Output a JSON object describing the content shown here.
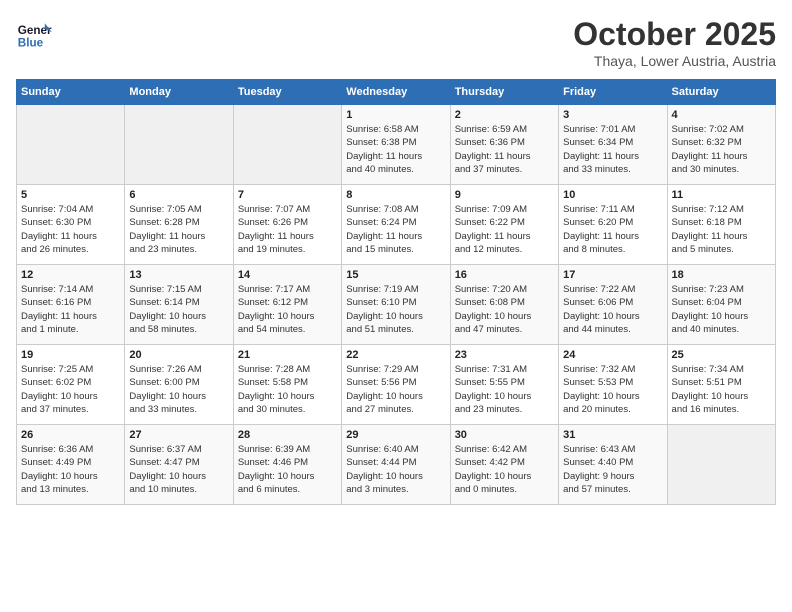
{
  "header": {
    "logo_general": "General",
    "logo_blue": "Blue",
    "month": "October 2025",
    "location": "Thaya, Lower Austria, Austria"
  },
  "days_of_week": [
    "Sunday",
    "Monday",
    "Tuesday",
    "Wednesday",
    "Thursday",
    "Friday",
    "Saturday"
  ],
  "weeks": [
    [
      {
        "day": "",
        "info": ""
      },
      {
        "day": "",
        "info": ""
      },
      {
        "day": "",
        "info": ""
      },
      {
        "day": "1",
        "info": "Sunrise: 6:58 AM\nSunset: 6:38 PM\nDaylight: 11 hours\nand 40 minutes."
      },
      {
        "day": "2",
        "info": "Sunrise: 6:59 AM\nSunset: 6:36 PM\nDaylight: 11 hours\nand 37 minutes."
      },
      {
        "day": "3",
        "info": "Sunrise: 7:01 AM\nSunset: 6:34 PM\nDaylight: 11 hours\nand 33 minutes."
      },
      {
        "day": "4",
        "info": "Sunrise: 7:02 AM\nSunset: 6:32 PM\nDaylight: 11 hours\nand 30 minutes."
      }
    ],
    [
      {
        "day": "5",
        "info": "Sunrise: 7:04 AM\nSunset: 6:30 PM\nDaylight: 11 hours\nand 26 minutes."
      },
      {
        "day": "6",
        "info": "Sunrise: 7:05 AM\nSunset: 6:28 PM\nDaylight: 11 hours\nand 23 minutes."
      },
      {
        "day": "7",
        "info": "Sunrise: 7:07 AM\nSunset: 6:26 PM\nDaylight: 11 hours\nand 19 minutes."
      },
      {
        "day": "8",
        "info": "Sunrise: 7:08 AM\nSunset: 6:24 PM\nDaylight: 11 hours\nand 15 minutes."
      },
      {
        "day": "9",
        "info": "Sunrise: 7:09 AM\nSunset: 6:22 PM\nDaylight: 11 hours\nand 12 minutes."
      },
      {
        "day": "10",
        "info": "Sunrise: 7:11 AM\nSunset: 6:20 PM\nDaylight: 11 hours\nand 8 minutes."
      },
      {
        "day": "11",
        "info": "Sunrise: 7:12 AM\nSunset: 6:18 PM\nDaylight: 11 hours\nand 5 minutes."
      }
    ],
    [
      {
        "day": "12",
        "info": "Sunrise: 7:14 AM\nSunset: 6:16 PM\nDaylight: 11 hours\nand 1 minute."
      },
      {
        "day": "13",
        "info": "Sunrise: 7:15 AM\nSunset: 6:14 PM\nDaylight: 10 hours\nand 58 minutes."
      },
      {
        "day": "14",
        "info": "Sunrise: 7:17 AM\nSunset: 6:12 PM\nDaylight: 10 hours\nand 54 minutes."
      },
      {
        "day": "15",
        "info": "Sunrise: 7:19 AM\nSunset: 6:10 PM\nDaylight: 10 hours\nand 51 minutes."
      },
      {
        "day": "16",
        "info": "Sunrise: 7:20 AM\nSunset: 6:08 PM\nDaylight: 10 hours\nand 47 minutes."
      },
      {
        "day": "17",
        "info": "Sunrise: 7:22 AM\nSunset: 6:06 PM\nDaylight: 10 hours\nand 44 minutes."
      },
      {
        "day": "18",
        "info": "Sunrise: 7:23 AM\nSunset: 6:04 PM\nDaylight: 10 hours\nand 40 minutes."
      }
    ],
    [
      {
        "day": "19",
        "info": "Sunrise: 7:25 AM\nSunset: 6:02 PM\nDaylight: 10 hours\nand 37 minutes."
      },
      {
        "day": "20",
        "info": "Sunrise: 7:26 AM\nSunset: 6:00 PM\nDaylight: 10 hours\nand 33 minutes."
      },
      {
        "day": "21",
        "info": "Sunrise: 7:28 AM\nSunset: 5:58 PM\nDaylight: 10 hours\nand 30 minutes."
      },
      {
        "day": "22",
        "info": "Sunrise: 7:29 AM\nSunset: 5:56 PM\nDaylight: 10 hours\nand 27 minutes."
      },
      {
        "day": "23",
        "info": "Sunrise: 7:31 AM\nSunset: 5:55 PM\nDaylight: 10 hours\nand 23 minutes."
      },
      {
        "day": "24",
        "info": "Sunrise: 7:32 AM\nSunset: 5:53 PM\nDaylight: 10 hours\nand 20 minutes."
      },
      {
        "day": "25",
        "info": "Sunrise: 7:34 AM\nSunset: 5:51 PM\nDaylight: 10 hours\nand 16 minutes."
      }
    ],
    [
      {
        "day": "26",
        "info": "Sunrise: 6:36 AM\nSunset: 4:49 PM\nDaylight: 10 hours\nand 13 minutes."
      },
      {
        "day": "27",
        "info": "Sunrise: 6:37 AM\nSunset: 4:47 PM\nDaylight: 10 hours\nand 10 minutes."
      },
      {
        "day": "28",
        "info": "Sunrise: 6:39 AM\nSunset: 4:46 PM\nDaylight: 10 hours\nand 6 minutes."
      },
      {
        "day": "29",
        "info": "Sunrise: 6:40 AM\nSunset: 4:44 PM\nDaylight: 10 hours\nand 3 minutes."
      },
      {
        "day": "30",
        "info": "Sunrise: 6:42 AM\nSunset: 4:42 PM\nDaylight: 10 hours\nand 0 minutes."
      },
      {
        "day": "31",
        "info": "Sunrise: 6:43 AM\nSunset: 4:40 PM\nDaylight: 9 hours\nand 57 minutes."
      },
      {
        "day": "",
        "info": ""
      }
    ]
  ]
}
